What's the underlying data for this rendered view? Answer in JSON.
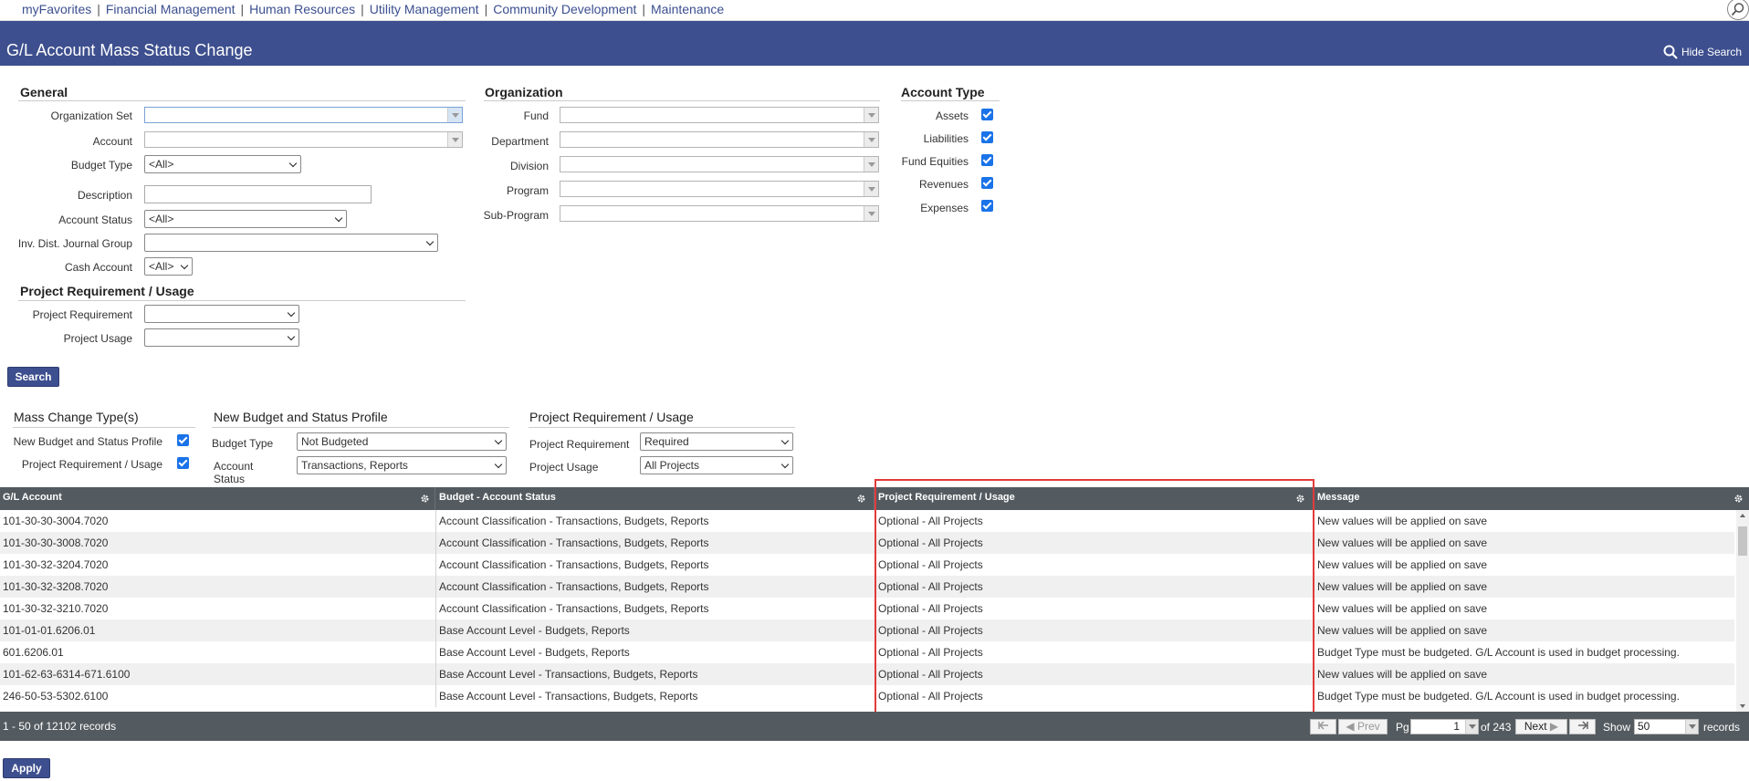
{
  "nav": {
    "links": [
      "myFavorites",
      "Financial Management",
      "Human Resources",
      "Utility Management",
      "Community Development",
      "Maintenance"
    ],
    "separator": "|"
  },
  "title": "G/L Account Mass Status Change",
  "hide_search": "Hide Search",
  "general": {
    "title": "General",
    "organization_set": "Organization Set",
    "account": "Account",
    "budget_type": "Budget Type",
    "budget_type_value": "<All>",
    "description": "Description",
    "account_status": "Account Status",
    "account_status_value": "<All>",
    "inv_dist_journal_group": "Inv. Dist. Journal Group",
    "cash_account": "Cash Account",
    "cash_account_value": "<All>"
  },
  "proj_filter": {
    "title": "Project Requirement / Usage",
    "requirement": "Project Requirement",
    "usage": "Project Usage"
  },
  "organization": {
    "title": "Organization",
    "fund": "Fund",
    "department": "Department",
    "division": "Division",
    "program": "Program",
    "sub_program": "Sub-Program"
  },
  "account_type": {
    "title": "Account Type",
    "assets": "Assets",
    "liabilities": "Liabilities",
    "fund_equities": "Fund Equities",
    "revenues": "Revenues",
    "expenses": "Expenses"
  },
  "search_button": "Search",
  "mass_change": {
    "title": "Mass Change Type(s)",
    "new_budget": "New Budget and Status Profile",
    "proj_req": "Project Requirement / Usage"
  },
  "new_budget_profile": {
    "title": "New Budget and Status Profile",
    "budget_type": "Budget Type",
    "budget_type_value": "Not Budgeted",
    "account_status": "Account Status",
    "account_status_value": "Transactions, Reports"
  },
  "proj_req_usage": {
    "title": "Project Requirement / Usage",
    "requirement": "Project Requirement",
    "requirement_value": "Required",
    "usage": "Project Usage",
    "usage_value": "All Projects"
  },
  "grid": {
    "columns": [
      "G/L Account",
      "Budget - Account Status",
      "Project Requirement / Usage",
      "Message"
    ],
    "rows": [
      [
        "101-30-30-3004.7020",
        "Account Classification - Transactions, Budgets, Reports",
        "Optional - All Projects",
        "New values will be applied on save"
      ],
      [
        "101-30-30-3008.7020",
        "Account Classification - Transactions, Budgets, Reports",
        "Optional - All Projects",
        "New values will be applied on save"
      ],
      [
        "101-30-32-3204.7020",
        "Account Classification - Transactions, Budgets, Reports",
        "Optional - All Projects",
        "New values will be applied on save"
      ],
      [
        "101-30-32-3208.7020",
        "Account Classification - Transactions, Budgets, Reports",
        "Optional - All Projects",
        "New values will be applied on save"
      ],
      [
        "101-30-32-3210.7020",
        "Account Classification - Transactions, Budgets, Reports",
        "Optional - All Projects",
        "New values will be applied on save"
      ],
      [
        "101-01-01.6206.01",
        "Base Account Level - Budgets, Reports",
        "Optional - All Projects",
        "New values will be applied on save"
      ],
      [
        "601.6206.01",
        "Base Account Level - Budgets, Reports",
        "Optional - All Projects",
        "Budget Type must be budgeted. G/L Account is used in budget processing."
      ],
      [
        "101-62-63-6314-671.6100",
        "Base Account Level - Transactions, Budgets, Reports",
        "Optional - All Projects",
        "New values will be applied on save"
      ],
      [
        "246-50-53-5302.6100",
        "Base Account Level - Transactions, Budgets, Reports",
        "Optional - All Projects",
        "Budget Type must be budgeted. G/L Account is used in budget processing."
      ]
    ]
  },
  "pager": {
    "summary": "1 - 50 of 12102 records",
    "prev": "Prev",
    "pg": "Pg",
    "page": "1",
    "of": "of 243",
    "next": "Next",
    "show": "Show",
    "page_size": "50",
    "records": "records"
  },
  "apply_button": "Apply"
}
